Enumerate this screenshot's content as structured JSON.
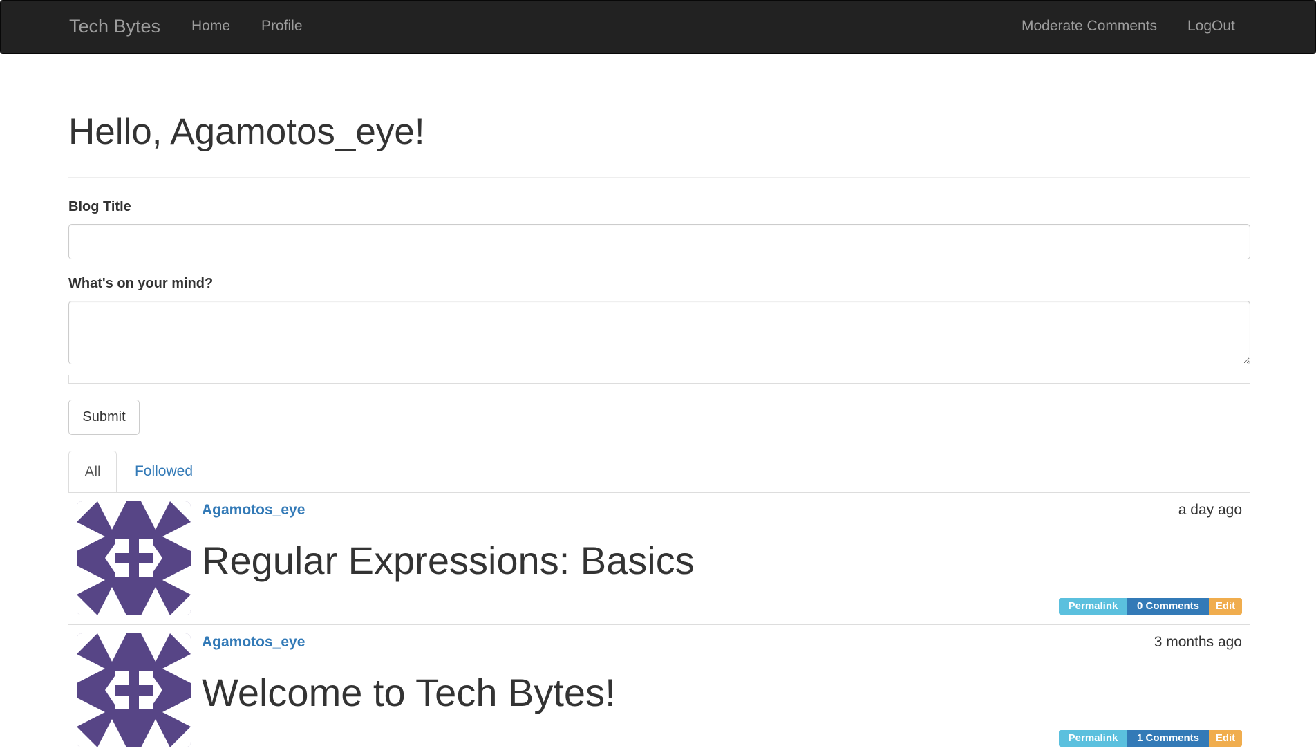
{
  "navbar": {
    "brand": "Tech Bytes",
    "left_links": [
      "Home",
      "Profile"
    ],
    "right_links": [
      "Moderate Comments",
      "LogOut"
    ]
  },
  "header": {
    "greeting": "Hello, Agamotos_eye!"
  },
  "form": {
    "title_label": "Blog Title",
    "title_value": "",
    "body_label": "What's on your mind?",
    "body_value": "",
    "submit_label": "Submit"
  },
  "tabs": [
    {
      "label": "All",
      "active": true
    },
    {
      "label": "Followed",
      "active": false
    }
  ],
  "posts": [
    {
      "author": "Agamotos_eye",
      "time": "a day ago",
      "title": "Regular Expressions: Basics",
      "permalink_label": "Permalink",
      "comments_label": "0 Comments",
      "edit_label": "Edit"
    },
    {
      "author": "Agamotos_eye",
      "time": "3 months ago",
      "title": "Welcome to Tech Bytes!",
      "permalink_label": "Permalink",
      "comments_label": "1 Comments",
      "edit_label": "Edit"
    }
  ],
  "icons": {
    "avatar": "identicon-avatar"
  },
  "colors": {
    "navbar_bg": "#222222",
    "navbar_text": "#9d9d9d",
    "link": "#337ab7",
    "badge_info": "#5bc0de",
    "badge_primary": "#337ab7",
    "badge_warning": "#f0ad4e",
    "identicon": "#574586"
  }
}
